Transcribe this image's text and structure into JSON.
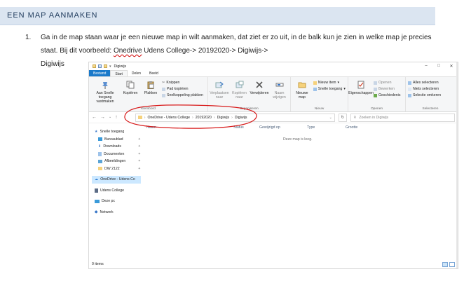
{
  "heading": "EEN MAP AANMAKEN",
  "step": {
    "number": "1.",
    "text_before": "Ga in de map staan waar je een nieuwe map in wilt aanmaken, dat ziet er zo uit, in de balk kun je zien in welke map je precies staat. Bij dit voorbeeld: ",
    "underlined": "Onedrive",
    "text_after": " Udens College-> 20192020-> Digiwijs->",
    "line_last": "Digiwijs"
  },
  "explorer": {
    "title": "Digiwijs",
    "window_controls": [
      "–",
      "□",
      "✕"
    ],
    "tabs": [
      "Bestand",
      "Start",
      "Delen",
      "Beeld"
    ],
    "ribbon": {
      "clipboard": {
        "group_name": "Klembord",
        "pin_label": "Aan Snelle toegang vastmaken",
        "copy_label": "Kopiëren",
        "paste_label": "Plakken",
        "cut_label": "Knippen",
        "copy_path_label": "Pad kopiëren",
        "paste_shortcut_label": "Snelkoppeling plakken"
      },
      "organize": {
        "group_name": "Organiseren",
        "move_label": "Verplaatsen naar",
        "copyto_label": "Kopiëren naar",
        "delete_label": "Verwijderen",
        "rename_label": "Naam wijzigen"
      },
      "new": {
        "group_name": "Nieuw",
        "newfolder_label": "Nieuwe map",
        "newitem_label": "Nieuw item",
        "easyaccess_label": "Snelle toegang"
      },
      "open": {
        "group_name": "Openen",
        "properties_label": "Eigenschappen",
        "open_label": "Openen",
        "edit_label": "Bewerken",
        "history_label": "Geschiedenis"
      },
      "select": {
        "group_name": "Selecteren",
        "select_all": "Alles selecteren",
        "select_none": "Niets selecteren",
        "invert": "Selectie omkeren"
      }
    },
    "address": {
      "path": [
        "OneDrive - Udens College",
        "20192020",
        "Digiwijs",
        "Digiwijs"
      ],
      "search_placeholder": "Zoeken in Digiwijs"
    },
    "nav": [
      {
        "label": "Snelle toegang",
        "icon": "star-icon",
        "pinned": false
      },
      {
        "label": "Bureaublad",
        "icon": "desktop-icon",
        "pinned": true
      },
      {
        "label": "Downloads",
        "icon": "download-icon",
        "pinned": true
      },
      {
        "label": "Documenten",
        "icon": "document-icon",
        "pinned": true
      },
      {
        "label": "Afbeeldingen",
        "icon": "picture-icon",
        "pinned": true
      },
      {
        "label": "DW 2122",
        "icon": "folder-icon",
        "pinned": true
      },
      {
        "label": "OneDrive - Udens Co",
        "icon": "cloud-icon",
        "pinned": false
      },
      {
        "label": "Udens College",
        "icon": "building-icon",
        "pinned": false
      },
      {
        "label": "Deze pc",
        "icon": "pc-icon",
        "pinned": false
      },
      {
        "label": "Netwerk",
        "icon": "network-icon",
        "pinned": false
      }
    ],
    "columns": [
      "Naam",
      "Status",
      "Gewijzigd op",
      "Type",
      "Grootte"
    ],
    "empty_message": "Deze map is leeg.",
    "status": "0 items",
    "colors": {
      "accent": "#1979ca",
      "selected": "#cce8ff",
      "annotation": "#d81b1b"
    }
  }
}
